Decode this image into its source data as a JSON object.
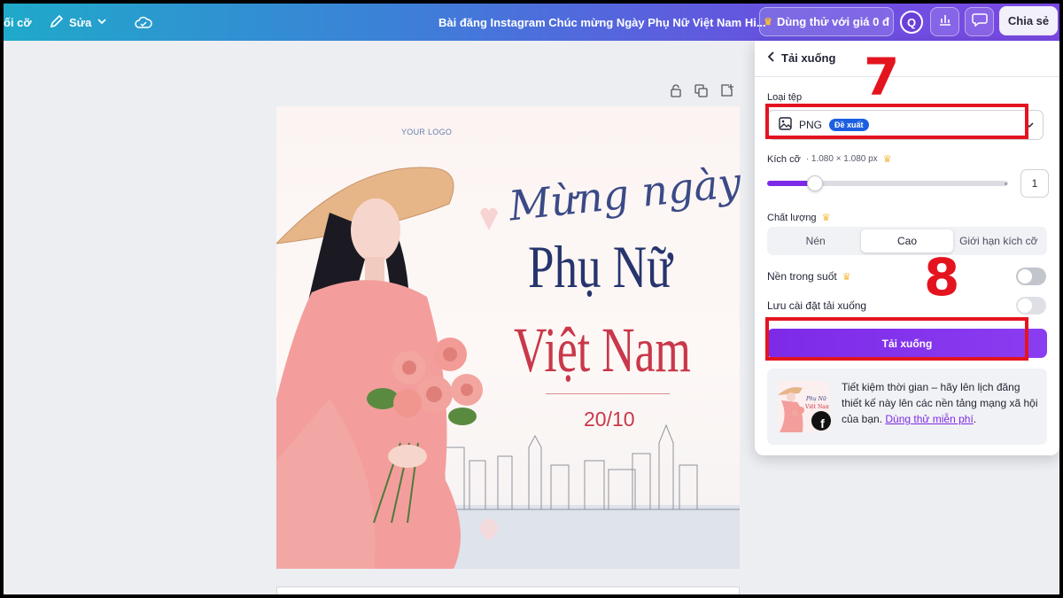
{
  "topbar": {
    "resize_label": "ối cỡ",
    "edit_label": "Sửa",
    "doc_title": "Bài đăng Instagram Chúc mừng Ngày Phụ Nữ Việt Nam Hi...",
    "trial_label": "Dùng thử với giá 0 đ",
    "avatar_initial": "Q",
    "share_label": "Chia sẻ"
  },
  "design": {
    "logo_text": "YOUR LOGO",
    "title_script": "Mừng ngày",
    "title_line2": "Phụ Nữ",
    "title_line3": "Việt Nam",
    "date": "20/10"
  },
  "download_panel": {
    "title": "Tải xuống",
    "file_type_label": "Loại tệp",
    "file_type_value": "PNG",
    "recommended_badge": "Đề xuất",
    "size_label": "Kích cỡ",
    "size_value": "· 1.080 × 1.080 px",
    "scale_fraction": 0.2,
    "scale_value": "1",
    "quality_label": "Chất lượng",
    "quality_options": [
      "Nén",
      "Cao",
      "Giới hạn kích cỡ"
    ],
    "quality_selected": "Cao",
    "transparent_bg_label": "Nền trong suốt",
    "transparent_bg_on": false,
    "save_settings_label": "Lưu cài đặt tải xuống",
    "save_settings_on": false,
    "download_button": "Tải xuống",
    "promo_text": "Tiết kiệm thời gian – hãy lên lịch đăng thiết kế này lên các nền tảng mạng xã hội của bạn. ",
    "promo_link": "Dùng thử miễn phí",
    "promo_end": "."
  },
  "annotations": {
    "marker_7": "7",
    "marker_8": "8"
  },
  "colors": {
    "accent": "#7d2ae8",
    "annotation_red": "#e4141f",
    "badge_blue": "#1d5fe0"
  },
  "icons": [
    "pencil-icon",
    "chevron-down-icon",
    "cloud-check-icon",
    "crown-icon",
    "bar-chart-icon",
    "comment-icon",
    "back-chevron-icon",
    "image-icon",
    "lock-icon",
    "duplicate-icon",
    "add-page-icon",
    "facebook-icon"
  ]
}
